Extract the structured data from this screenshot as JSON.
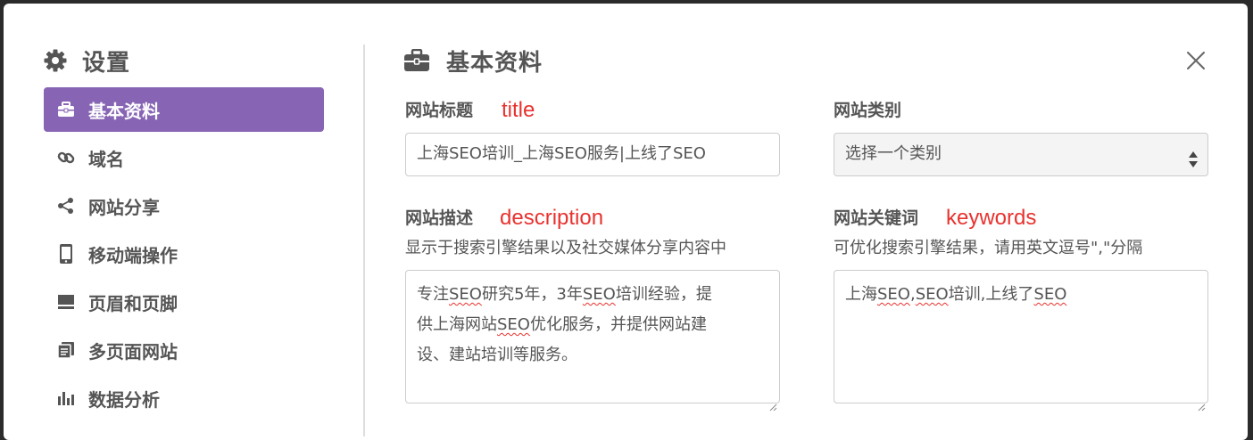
{
  "sidebar": {
    "title": "设置",
    "title_icon": "gear-icon",
    "items": [
      {
        "label": "基本资料",
        "icon": "briefcase-icon",
        "active": true
      },
      {
        "label": "域名",
        "icon": "link-icon",
        "active": false
      },
      {
        "label": "网站分享",
        "icon": "share-icon",
        "active": false
      },
      {
        "label": "移动端操作",
        "icon": "mobile-icon",
        "active": false
      },
      {
        "label": "页眉和页脚",
        "icon": "header-footer-icon",
        "active": false
      },
      {
        "label": "多页面网站",
        "icon": "pages-icon",
        "active": false
      },
      {
        "label": "数据分析",
        "icon": "bar-chart-icon",
        "active": false
      }
    ]
  },
  "main": {
    "title": "基本资料",
    "title_icon": "briefcase-icon",
    "close_icon": "close-icon",
    "site_title": {
      "label": "网站标题",
      "annotation": "title",
      "value": "上海SEO培训_上海SEO服务|上线了SEO"
    },
    "category": {
      "label": "网站类别",
      "selected": "选择一个类别"
    },
    "description": {
      "label": "网站描述",
      "annotation": "description",
      "help": "显示于搜索引擎结果以及社交媒体分享内容中",
      "lines": [
        {
          "a": "专注",
          "b": "SEO",
          "c": "研究5年，3年",
          "d": "SEO",
          "e": "培训经验，提"
        },
        {
          "a": "供上海网站",
          "b": "SEO",
          "c": "优化服务，并提供网站建"
        },
        {
          "a": "设、建站培训等服务。"
        }
      ]
    },
    "keywords": {
      "label": "网站关键词",
      "annotation": "keywords",
      "help": "可优化搜索引擎结果，请用英文逗号\",\"分隔",
      "parts": {
        "a": "上海",
        "b": "SEO",
        "c": ",",
        "d": "SEO",
        "e": "培训,上线了",
        "f": "SEO"
      }
    }
  },
  "colors": {
    "accent": "#8765b4",
    "annotation": "#e8322e",
    "text": "#555555"
  }
}
